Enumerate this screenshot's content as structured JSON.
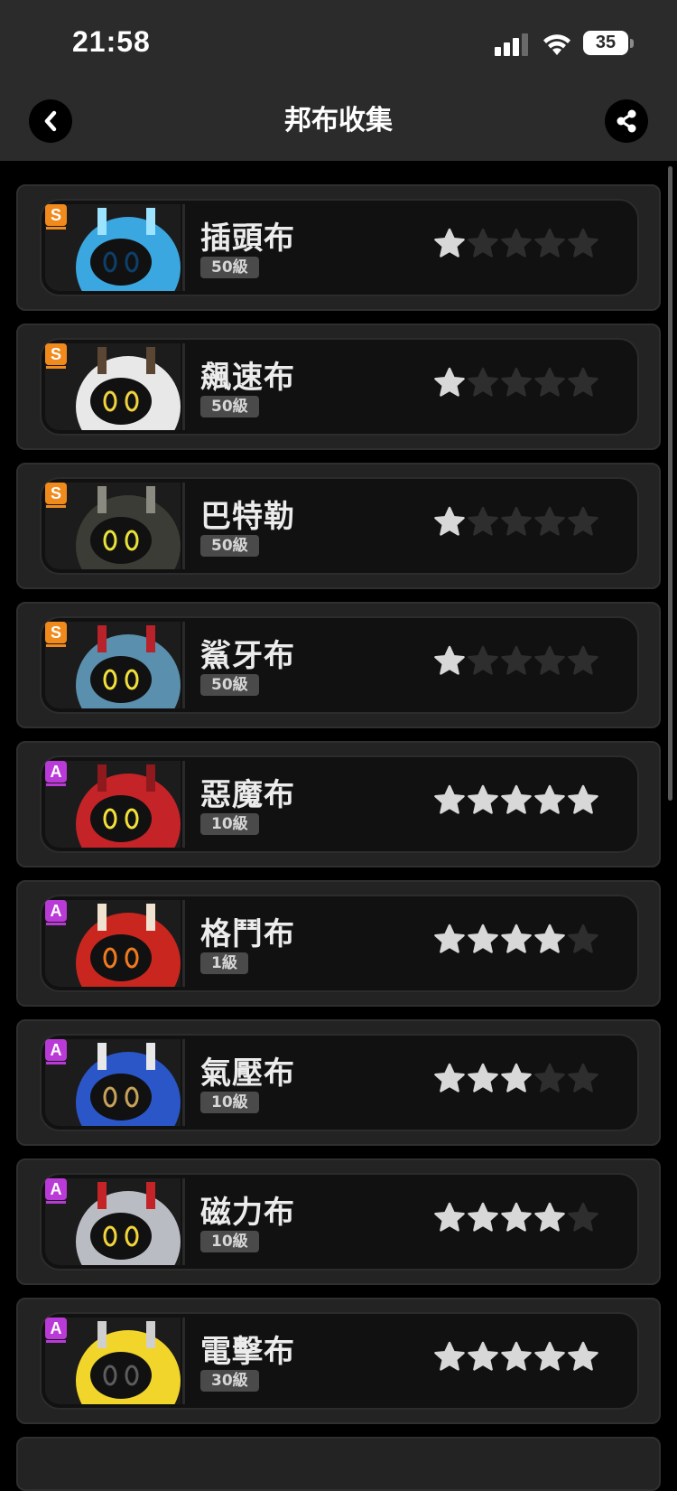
{
  "status_bar": {
    "time": "21:58",
    "battery": "35"
  },
  "header": {
    "title": "邦布收集",
    "back_icon": "chevron-left-icon",
    "share_icon": "share-icon"
  },
  "colors": {
    "rank_s": "#f08a1c",
    "rank_a": "#b93ad6",
    "star_filled": "#d8d8d8",
    "star_empty": "#2e2e2e"
  },
  "bangboos": [
    {
      "name": "插頭布",
      "level": "50級",
      "rank": "S",
      "stars": 1,
      "body": "#3aa7e0",
      "accent": "#9be3ff",
      "eyes": "#0e3f6b"
    },
    {
      "name": "飆速布",
      "level": "50級",
      "rank": "S",
      "stars": 1,
      "body": "#e8e8e8",
      "accent": "#5a4632",
      "eyes": "#f0d340"
    },
    {
      "name": "巴特勒",
      "level": "50級",
      "rank": "S",
      "stars": 1,
      "body": "#3c3c36",
      "accent": "#8a8a80",
      "eyes": "#e8e23a"
    },
    {
      "name": "鯊牙布",
      "level": "50級",
      "rank": "S",
      "stars": 1,
      "body": "#5a8fae",
      "accent": "#b8222a",
      "eyes": "#f3e03a"
    },
    {
      "name": "惡魔布",
      "level": "10級",
      "rank": "A",
      "stars": 5,
      "body": "#c42328",
      "accent": "#8e1a1d",
      "eyes": "#f3e03a"
    },
    {
      "name": "格鬥布",
      "level": "1級",
      "rank": "A",
      "stars": 4,
      "body": "#c8261f",
      "accent": "#f0e2d0",
      "eyes": "#f07a20"
    },
    {
      "name": "氣壓布",
      "level": "10級",
      "rank": "A",
      "stars": 3,
      "body": "#2a56c8",
      "accent": "#e8e8e8",
      "eyes": "#c9a25a"
    },
    {
      "name": "磁力布",
      "level": "10級",
      "rank": "A",
      "stars": 4,
      "body": "#b9bcc2",
      "accent": "#c42328",
      "eyes": "#f3d53a"
    },
    {
      "name": "電擊布",
      "level": "30級",
      "rank": "A",
      "stars": 5,
      "body": "#f1d52a",
      "accent": "#cfcfcf",
      "eyes": "#5c5c5c"
    }
  ]
}
